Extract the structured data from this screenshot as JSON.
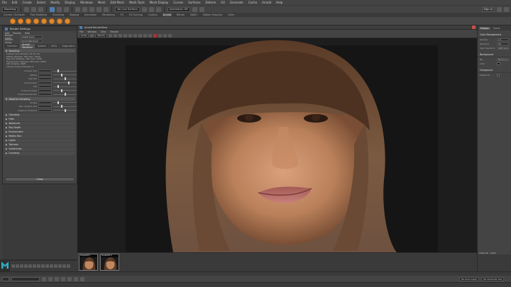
{
  "menubar": {
    "items": [
      "File",
      "Edit",
      "Create",
      "Select",
      "Modify",
      "Display",
      "Windows",
      "Mesh",
      "Edit Mesh",
      "Mesh Tools",
      "Mesh Display",
      "Curves",
      "Surfaces",
      "Deform",
      "UV",
      "Generate",
      "Cache",
      "Arnold",
      "Help"
    ]
  },
  "statusline": {
    "mode": "Modeling",
    "workspace_dropdown": "No Live Surface",
    "symmetry_dropdown": "Symmetry: Off",
    "sign_in": "Sign In"
  },
  "shelf": {
    "tabs": [
      "Curves / Surfaces",
      "Poly Modeling",
      "Sculpting",
      "Rigging",
      "Animation",
      "Rendering",
      "FX",
      "FX Caching",
      "Custom",
      "Arnold",
      "Bifrost",
      "MASH",
      "Motion Graphics",
      "XGen"
    ],
    "active_tab": "Arnold"
  },
  "render_settings": {
    "title": "Render Settings",
    "menu": [
      "Edit",
      "Presets",
      "Help"
    ],
    "render_layer_label": "Render Layer",
    "render_layer_value": "masterLayer",
    "render_using_label": "Render Using",
    "render_using_value": "Arnold Renderer",
    "tabs": [
      "Common",
      "Arnold Renderer",
      "System",
      "AOVs",
      "Diagnostics"
    ],
    "active_tab": "Arnold Renderer",
    "sampling_section": "Sampling",
    "info_lines": [
      "Camera (AA) Samples: 64 (6x AA)",
      "Diffuse Samples: 768 (max: 2304)",
      "Specular Samples: 768 (max: 2304)",
      "Transmission Samples: 768 (max: 2304)",
      "SSS Samples: 4608",
      "Volume Indirect Samples: 0"
    ],
    "properties": [
      "Camera (AA)",
      "Diffuse",
      "Specular",
      "Transmission",
      "SSS",
      "Volume Indirect",
      "Progressive Render"
    ],
    "adaptive_section": "Adaptive Sampling",
    "adaptive_properties": [
      "Enable",
      "Max. Camera (AA)",
      "Adaptive Threshold"
    ],
    "collapsed_sections": [
      "Clamping",
      "Filter",
      "Advanced",
      "Ray Depth",
      "Environment",
      "Motion Blur",
      "Lights",
      "Textures",
      "Subdivision",
      "Licensing"
    ],
    "close_label": "Close"
  },
  "render_view": {
    "title": "Arnold RenderView",
    "menu": [
      "File",
      "Window",
      "View",
      "Render"
    ],
    "camera_dropdown": "persp",
    "aov_dropdown": "Beauty",
    "snapshots": [
      {
        "label": "Snapshot 1"
      },
      {
        "label": "Snapshot 2"
      }
    ],
    "status_text": "00:01:26 | 1280x720 (1:1) | camera: persp | samples: 4/4/4/4/4/4 | Memory 2.84 GB"
  },
  "attribute_editor": {
    "tabs": [
      "Display",
      "Scene"
    ],
    "active_tab": "Display",
    "color_management_header": "Color Management",
    "rows": [
      {
        "label": "Gamma",
        "value": "1.0"
      },
      {
        "label": "Exposure",
        "value": "0.0"
      },
      {
        "label": "View Transform",
        "value": "sRGB gamma"
      }
    ],
    "background_header": "Background",
    "bg_label": "BG",
    "bg_value": "Background",
    "color_label": "Color",
    "foreground_header": "Foreground",
    "enable_fg_label": "Enable FG",
    "bottom_tabs": [
      "Channels",
      "Layer"
    ]
  },
  "helpline": {
    "anim_layer": "No Anim Layer",
    "character_set": "No Character Set"
  },
  "colors": {
    "accent": "#4d7fae",
    "shelf_icon": "#e08a2e"
  }
}
